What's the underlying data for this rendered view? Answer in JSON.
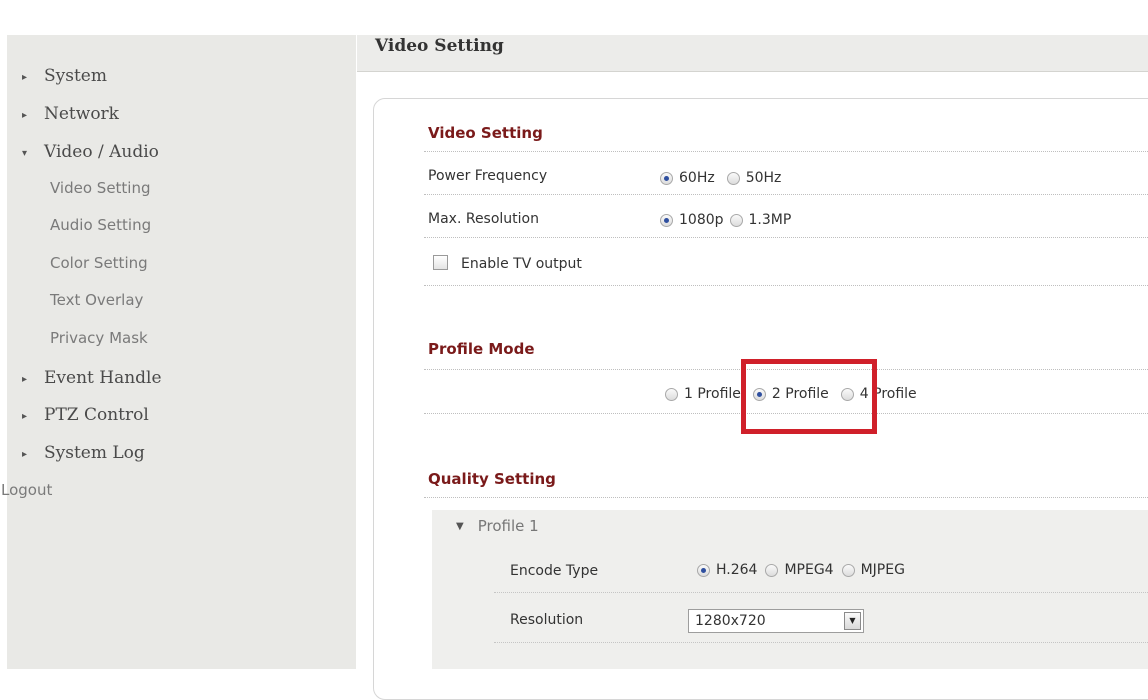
{
  "sidebar": {
    "items": [
      {
        "label": "System",
        "arrow": "▸"
      },
      {
        "label": "Network",
        "arrow": "▸"
      },
      {
        "label": "Video / Audio",
        "arrow": "▾"
      },
      {
        "label": "Event Handle",
        "arrow": "▸"
      },
      {
        "label": "PTZ Control",
        "arrow": "▸"
      },
      {
        "label": "System Log",
        "arrow": "▸"
      }
    ],
    "subitems": [
      "Video Setting",
      "Audio Setting",
      "Color Setting",
      "Text Overlay",
      "Privacy Mask"
    ],
    "logout": "Logout"
  },
  "header": {
    "title": "Video Setting"
  },
  "video_setting": {
    "title": "Video Setting",
    "power_frequency": {
      "label": "Power Frequency",
      "options": [
        "60Hz",
        "50Hz"
      ],
      "selected": "60Hz"
    },
    "max_resolution": {
      "label": "Max. Resolution",
      "options": [
        "1080p",
        "1.3MP"
      ],
      "selected": "1080p"
    },
    "tv_output": {
      "label": "Enable TV output",
      "checked": false
    }
  },
  "profile_mode": {
    "title": "Profile Mode",
    "options": [
      "1 Profile",
      "2 Profile",
      "4 Profile"
    ],
    "selected": "2 Profile"
  },
  "quality_setting": {
    "title": "Quality Setting",
    "profile_label": "Profile 1",
    "encode_type": {
      "label": "Encode Type",
      "options": [
        "H.264",
        "MPEG4",
        "MJPEG"
      ],
      "selected": "H.264"
    },
    "resolution": {
      "label": "Resolution",
      "value": "1280x720"
    }
  },
  "colors": {
    "accent": "#7a1a1a",
    "highlight": "#d0202a",
    "sidebar_bg": "#e9e9e6"
  }
}
